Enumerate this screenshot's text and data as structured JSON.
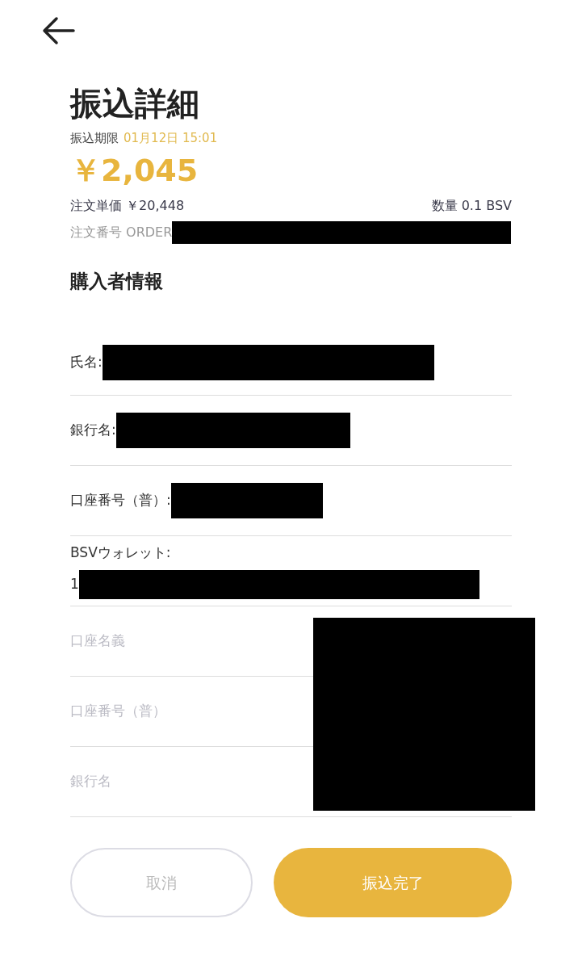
{
  "title": "振込詳細",
  "deadline": {
    "label": "振込期限",
    "value": "01月12日 15:01"
  },
  "amount": "￥2,045",
  "unit_price": "注文単価 ￥20,448",
  "quantity": "数量 0.1 BSV",
  "order_number": {
    "text": "注文番号 ORDER",
    "redacted": true
  },
  "section_title": "購入者情報",
  "fields": [
    {
      "kind": "info",
      "label": "氏名:",
      "redacted": true
    },
    {
      "kind": "info",
      "label": "銀行名:",
      "redacted": true
    },
    {
      "kind": "info",
      "label": "口座番号（普）:",
      "redacted": true
    },
    {
      "kind": "stacked",
      "label": "BSVウォレット:",
      "value": "1",
      "redacted": true
    },
    {
      "kind": "input",
      "placeholder": "口座名義"
    },
    {
      "kind": "input",
      "placeholder": "口座番号（普）"
    },
    {
      "kind": "input",
      "placeholder": "銀行名"
    }
  ],
  "inputs_redacted": true,
  "buttons": [
    {
      "kind": "secondary",
      "label": "取消"
    },
    {
      "kind": "primary",
      "label": "振込完了"
    }
  ]
}
